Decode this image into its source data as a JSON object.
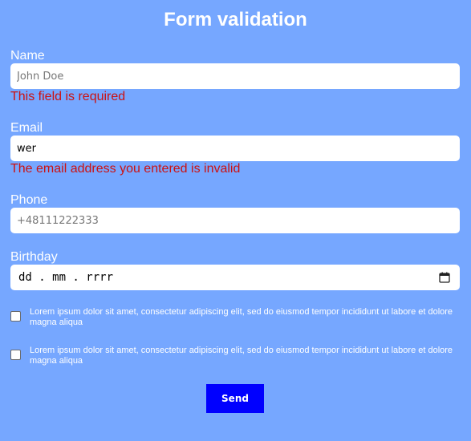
{
  "form": {
    "title": "Form validation",
    "name": {
      "label": "Name",
      "placeholder": "John Doe",
      "value": "",
      "error": "This field is required"
    },
    "email": {
      "label": "Email",
      "placeholder": "",
      "value": "wer",
      "error": "The email address you entered is invalid"
    },
    "phone": {
      "label": "Phone",
      "placeholder": "+48111222333",
      "value": ""
    },
    "birthday": {
      "label": "Birthday",
      "display": "dd . mm . rrrr",
      "icon": "calendar-icon"
    },
    "consents": [
      {
        "checked": false,
        "text": "Lorem ipsum dolor sit amet, consectetur adipiscing elit, sed do eiusmod tempor incididunt ut labore et dolore magna aliqua"
      },
      {
        "checked": false,
        "text": "Lorem ipsum dolor sit amet, consectetur adipiscing elit, sed do eiusmod tempor incididunt ut labore et dolore magna aliqua"
      }
    ],
    "submit_label": "Send"
  },
  "colors": {
    "background": "#76a7ff",
    "error": "#cc1111",
    "button": "#0000ff",
    "text": "#ffffff"
  }
}
